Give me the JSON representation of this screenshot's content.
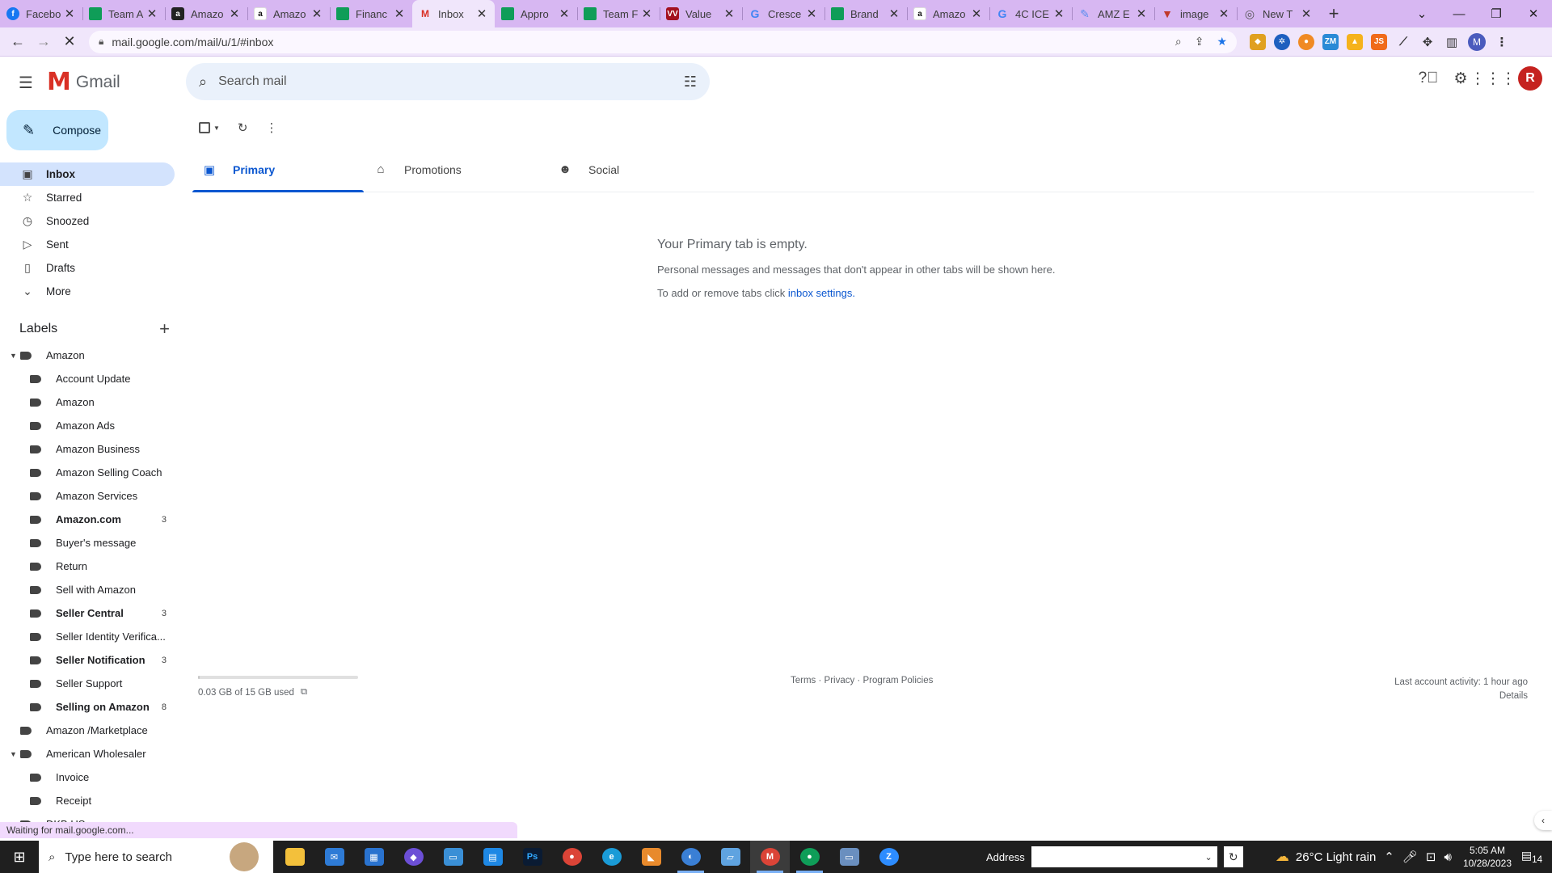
{
  "browser": {
    "tabs": [
      {
        "title": "Facebo",
        "fav": "fb",
        "fav_text": "f",
        "active": false
      },
      {
        "title": "Team A",
        "fav": "sheets",
        "fav_text": "",
        "active": false
      },
      {
        "title": "Amazo",
        "fav": "amzb",
        "fav_text": "a",
        "active": false
      },
      {
        "title": "Amazo",
        "fav": "amz",
        "fav_text": "a",
        "active": false
      },
      {
        "title": "Financ",
        "fav": "sheets",
        "fav_text": "",
        "active": false
      },
      {
        "title": "Inbox",
        "fav": "gm",
        "fav_text": "M",
        "active": true
      },
      {
        "title": "Appro",
        "fav": "sheets",
        "fav_text": "",
        "active": false
      },
      {
        "title": "Team F",
        "fav": "sheets",
        "fav_text": "",
        "active": false
      },
      {
        "title": "Value",
        "fav": "vw",
        "fav_text": "VV",
        "active": false
      },
      {
        "title": "Cresce",
        "fav": "g",
        "fav_text": "G",
        "active": false
      },
      {
        "title": "Brand",
        "fav": "sheets",
        "fav_text": "",
        "active": false
      },
      {
        "title": "Amazo",
        "fav": "amz",
        "fav_text": "a",
        "active": false
      },
      {
        "title": "4C ICE",
        "fav": "g",
        "fav_text": "G",
        "active": false
      },
      {
        "title": "AMZ E",
        "fav": "amze",
        "fav_text": "✎",
        "active": false
      },
      {
        "title": "image",
        "fav": "img",
        "fav_text": "▼",
        "active": false
      },
      {
        "title": "New T",
        "fav": "new",
        "fav_text": "◎",
        "active": false
      }
    ],
    "url": "mail.google.com/mail/u/1/#inbox",
    "profile_initial": "M"
  },
  "gmail": {
    "logo_word": "Gmail",
    "search_placeholder": "Search mail",
    "avatar_initial": "R",
    "compose_label": "Compose",
    "nav": [
      {
        "label": "Inbox",
        "icon": "inbox-icon",
        "glyph": "▣",
        "active": true
      },
      {
        "label": "Starred",
        "icon": "star-icon",
        "glyph": "☆",
        "active": false
      },
      {
        "label": "Snoozed",
        "icon": "clock-icon",
        "glyph": "◷",
        "active": false
      },
      {
        "label": "Sent",
        "icon": "send-icon",
        "glyph": "▷",
        "active": false
      },
      {
        "label": "Drafts",
        "icon": "draft-icon",
        "glyph": "▯",
        "active": false
      },
      {
        "label": "More",
        "icon": "chevron-down-icon",
        "glyph": "⌄",
        "active": false
      }
    ],
    "labels_heading": "Labels",
    "labels": [
      {
        "name": "Amazon",
        "level": 1,
        "expanded": true,
        "bold": false,
        "count": ""
      },
      {
        "name": "Account Update",
        "level": 2,
        "bold": false,
        "count": ""
      },
      {
        "name": "Amazon",
        "level": 2,
        "bold": false,
        "count": ""
      },
      {
        "name": "Amazon Ads",
        "level": 2,
        "bold": false,
        "count": ""
      },
      {
        "name": "Amazon Business",
        "level": 2,
        "bold": false,
        "count": ""
      },
      {
        "name": "Amazon Selling Coach",
        "level": 2,
        "bold": false,
        "count": ""
      },
      {
        "name": "Amazon Services",
        "level": 2,
        "bold": false,
        "count": ""
      },
      {
        "name": "Amazon.com",
        "level": 2,
        "bold": true,
        "count": "3"
      },
      {
        "name": "Buyer's message",
        "level": 2,
        "bold": false,
        "count": ""
      },
      {
        "name": "Return",
        "level": 2,
        "bold": false,
        "count": ""
      },
      {
        "name": "Sell with Amazon",
        "level": 2,
        "bold": false,
        "count": ""
      },
      {
        "name": "Seller Central",
        "level": 2,
        "bold": true,
        "count": "3"
      },
      {
        "name": "Seller Identity Verifica...",
        "level": 2,
        "bold": false,
        "count": ""
      },
      {
        "name": "Seller Notification",
        "level": 2,
        "bold": true,
        "count": "3"
      },
      {
        "name": "Seller Support",
        "level": 2,
        "bold": false,
        "count": ""
      },
      {
        "name": "Selling on Amazon",
        "level": 2,
        "bold": true,
        "count": "8"
      },
      {
        "name": "Amazon /Marketplace",
        "level": 1,
        "expanded": false,
        "bold": false,
        "count": ""
      },
      {
        "name": "American Wholesaler",
        "level": 1,
        "expanded": true,
        "bold": false,
        "count": ""
      },
      {
        "name": "Invoice",
        "level": 2,
        "bold": false,
        "count": ""
      },
      {
        "name": "Receipt",
        "level": 2,
        "bold": false,
        "count": ""
      },
      {
        "name": "DKB US",
        "level": 1,
        "expanded": false,
        "bold": false,
        "count": ""
      }
    ],
    "tabs": [
      {
        "label": "Primary",
        "icon": "inbox-tab-icon",
        "glyph": "▣",
        "active": true
      },
      {
        "label": "Promotions",
        "icon": "tag-icon",
        "glyph": "⌂",
        "active": false
      },
      {
        "label": "Social",
        "icon": "people-icon",
        "glyph": "☻",
        "active": false
      }
    ],
    "empty": {
      "heading": "Your Primary tab is empty.",
      "line1": "Personal messages and messages that don't appear in other tabs will be shown here.",
      "line2_prefix": "To add or remove tabs click ",
      "line2_link": "inbox settings",
      "line2_suffix": "."
    },
    "footer": {
      "storage_used": "0.03 GB of 15 GB used",
      "storage_fraction": 0.002,
      "links": "Terms · Privacy · Program Policies",
      "last_activity": "Last account activity: 1 hour ago",
      "details": "Details"
    }
  },
  "status_text": "Waiting for mail.google.com...",
  "taskbar": {
    "search_placeholder": "Type here to search",
    "address_label": "Address",
    "weather": "26°C  Light rain",
    "time": "5:05 AM",
    "date": "10/28/2023",
    "notif_count": "14"
  }
}
